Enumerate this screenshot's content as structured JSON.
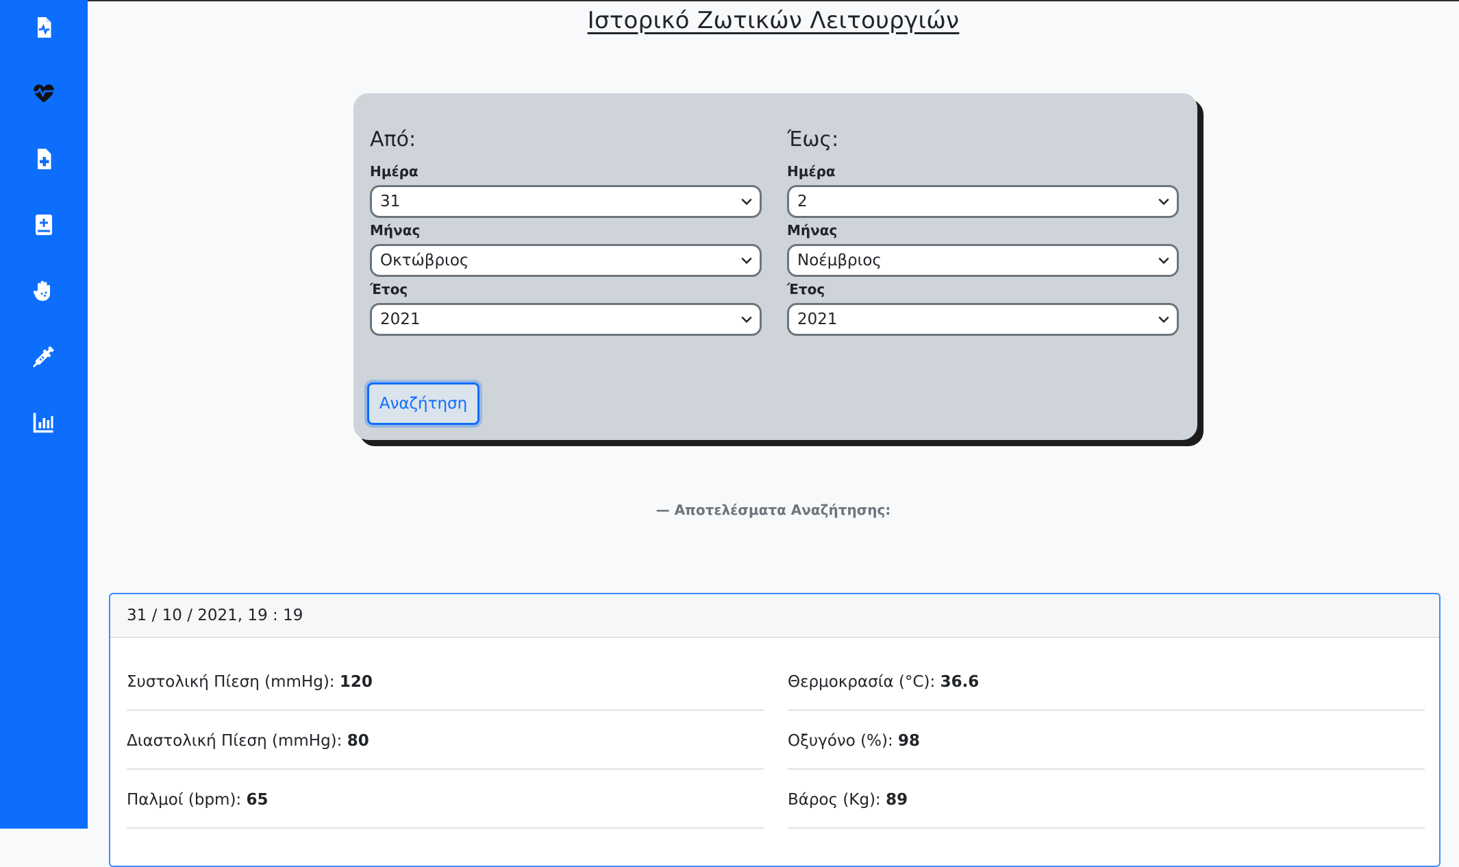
{
  "page": {
    "title": "Ιστορικό Ζωτικών Λειτουργιών"
  },
  "sidebar": {
    "icons": [
      "file-waveform-icon",
      "heart-pulse-icon",
      "file-medical-icon",
      "book-medical-icon",
      "hand-dots-icon",
      "syringe-icon",
      "chart-column-icon"
    ]
  },
  "search": {
    "from": {
      "title": "Από:",
      "day_label": "Ημέρα",
      "day": "31",
      "month_label": "Μήνας",
      "month": "Οκτώβριος",
      "year_label": "Έτος",
      "year": "2021"
    },
    "to": {
      "title": "Έως:",
      "day_label": "Ημέρα",
      "day": "2",
      "month_label": "Μήνας",
      "month": "Νοέμβριος",
      "year_label": "Έτος",
      "year": "2021"
    },
    "button": "Αναζήτηση"
  },
  "results": {
    "heading": "— Αποτελέσματα Αναζήτησης:",
    "records": [
      {
        "timestamp": "31 / 10 / 2021, 19 : 19",
        "metrics": [
          {
            "label": "Συστολική Πίεση (mmHg): ",
            "value": "120"
          },
          {
            "label": "Θερμοκρασία (°C): ",
            "value": "36.6"
          },
          {
            "label": "Διαστολική Πίεση (mmHg): ",
            "value": "80"
          },
          {
            "label": "Οξυγόνο (%): ",
            "value": "98"
          },
          {
            "label": "Παλμοί (bpm): ",
            "value": "65"
          },
          {
            "label": "Βάρος (Kg): ",
            "value": "89"
          }
        ]
      }
    ]
  },
  "colors": {
    "sidebar": "#0d6efd",
    "card": "#ced4da",
    "accent": "#0d6efd",
    "background": "#f8f9fa"
  }
}
